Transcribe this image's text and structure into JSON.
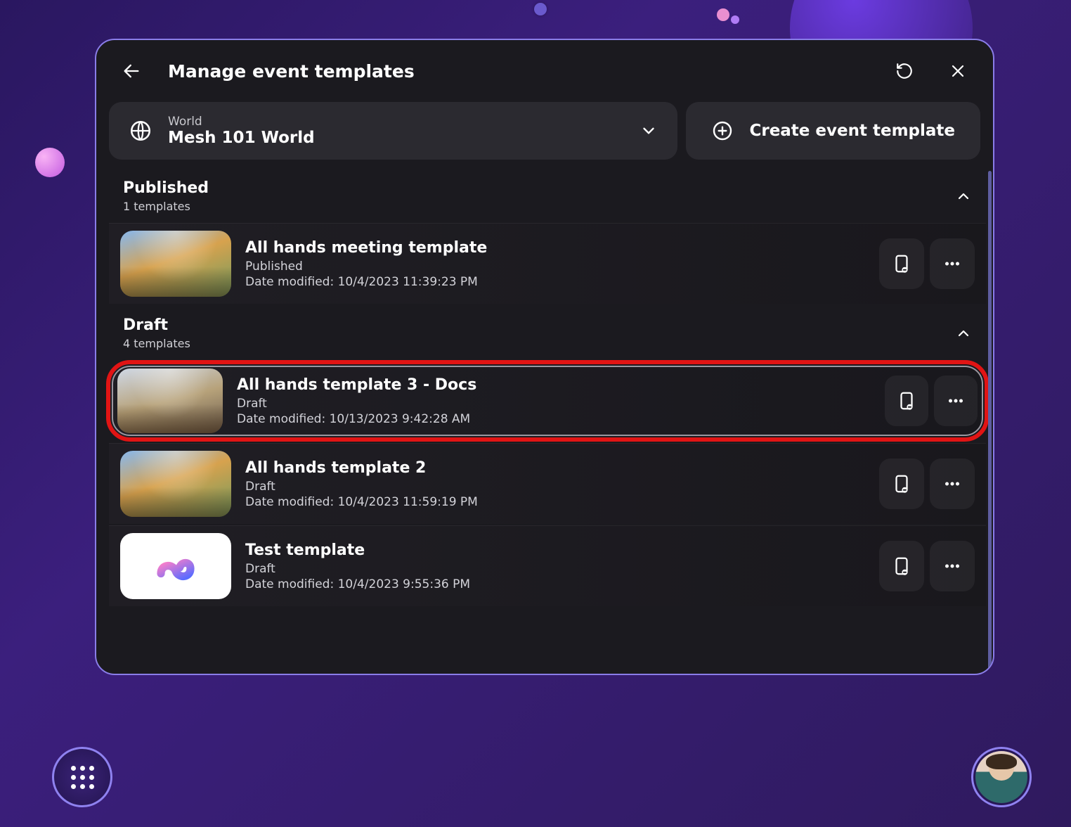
{
  "header": {
    "title": "Manage event templates"
  },
  "world": {
    "label": "World",
    "name": "Mesh 101 World"
  },
  "create": {
    "label": "Create event template"
  },
  "date_prefix": "Date modified:",
  "sections": [
    {
      "title": "Published",
      "subtitle": "1 templates",
      "items": [
        {
          "title": "All hands meeting template",
          "status": "Published",
          "date": "10/4/2023 11:39:23 PM",
          "thumb": "scene",
          "highlight": false
        }
      ]
    },
    {
      "title": "Draft",
      "subtitle": "4 templates",
      "items": [
        {
          "title": "All hands template 3 - Docs",
          "status": "Draft",
          "date": "10/13/2023 9:42:28 AM",
          "thumb": "indoor",
          "highlight": true
        },
        {
          "title": "All hands template 2",
          "status": "Draft",
          "date": "10/4/2023 11:59:19 PM",
          "thumb": "scene",
          "highlight": false
        },
        {
          "title": "Test template",
          "status": "Draft",
          "date": "10/4/2023 9:55:36 PM",
          "thumb": "logo",
          "highlight": false
        }
      ]
    }
  ]
}
